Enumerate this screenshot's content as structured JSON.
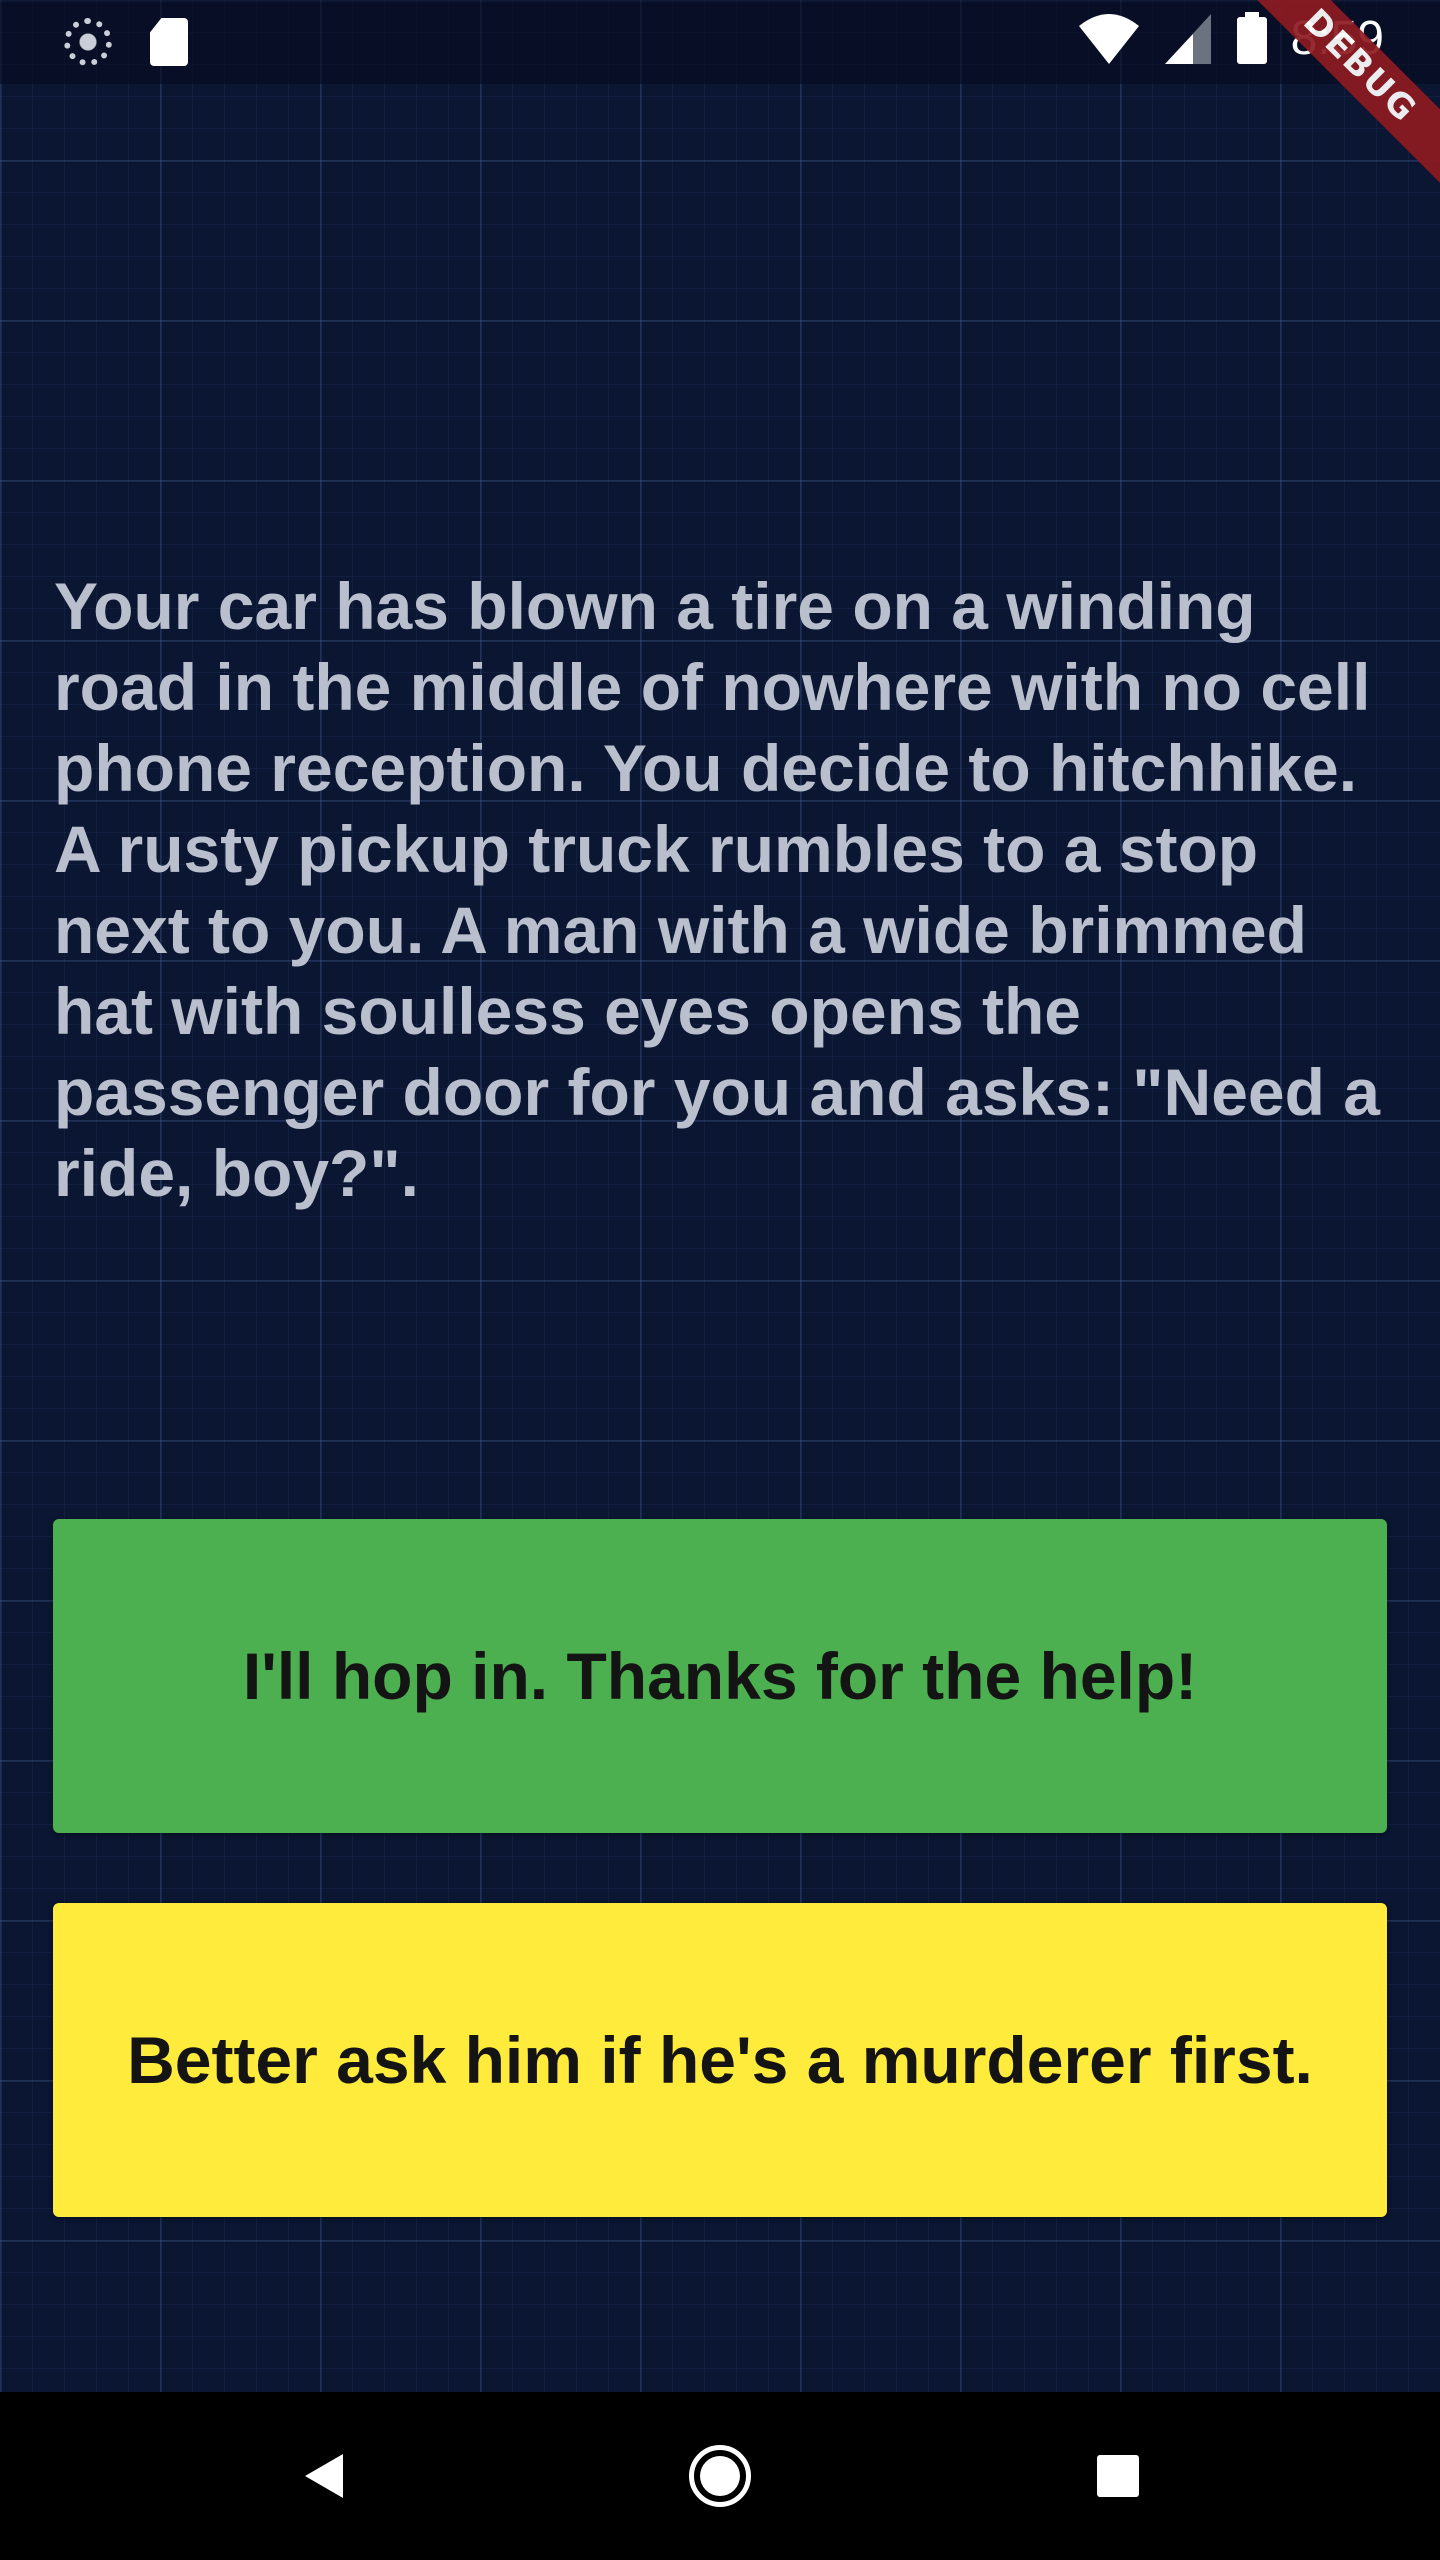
{
  "status_bar": {
    "time": "8:59",
    "icons": {
      "left": [
        "sync-icon",
        "sd-card-icon"
      ],
      "right": [
        "wifi-icon",
        "cell-signal-icon",
        "battery-icon"
      ]
    }
  },
  "debug_banner": {
    "label": "DEBUG",
    "color": "#8e1b21"
  },
  "story": {
    "text": "Your car has blown a tire on a winding road in the middle of nowhere with no cell phone reception. You decide to hitchhike. A rusty pickup truck rumbles to a stop next to you. A man with a wide brimmed hat with soulless eyes opens the passenger door for you and asks: \"Need a ride, boy?\"."
  },
  "choices": [
    {
      "label": "I'll hop in. Thanks for the help!",
      "color": "#4caf50"
    },
    {
      "label": "Better ask him if he's a murderer first.",
      "color": "#ffeb3b"
    }
  ],
  "nav_bar": {
    "icons": [
      "back-icon",
      "home-icon",
      "recent-apps-icon"
    ]
  },
  "colors": {
    "background": "#0b1633",
    "story_text": "#b9bfcc"
  }
}
